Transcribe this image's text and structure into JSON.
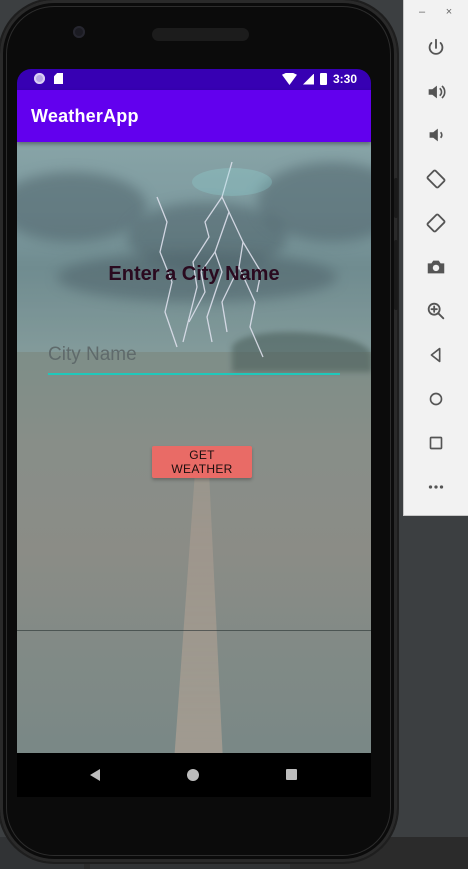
{
  "status_bar": {
    "time": "3:30",
    "icons": [
      "record-dot-icon",
      "sd-card-icon",
      "wifi-icon",
      "signal-icon",
      "battery-icon"
    ]
  },
  "app_bar": {
    "title": "WeatherApp",
    "color": "#6200ee",
    "status_color": "#3700b3"
  },
  "main": {
    "heading": "Enter a City Name",
    "city_input": {
      "placeholder": "City Name",
      "value": "",
      "underline_color": "#1fc8bb"
    },
    "get_weather_button": {
      "label": "GET WEATHER",
      "color": "#e96b66"
    }
  },
  "nav_bar": {
    "icons": [
      "back-icon",
      "home-icon",
      "recent-apps-icon"
    ]
  },
  "emulator_panel": {
    "window_controls": {
      "minimize": "–",
      "close": "×"
    },
    "buttons": [
      "power-icon",
      "volume-up-icon",
      "volume-down-icon",
      "rotate-left-icon",
      "rotate-right-icon",
      "camera-icon",
      "zoom-icon",
      "back-icon",
      "home-icon",
      "overview-icon",
      "more-icon"
    ]
  }
}
